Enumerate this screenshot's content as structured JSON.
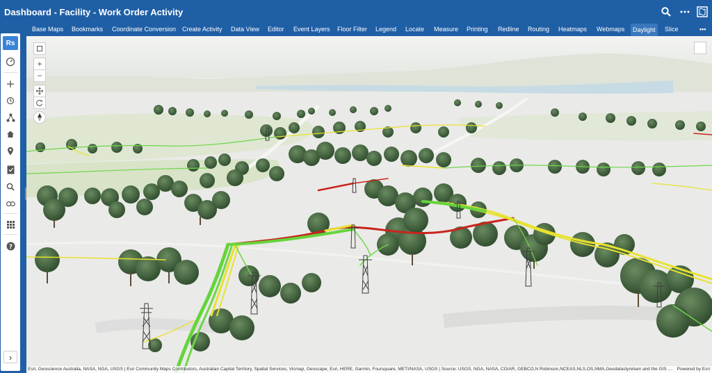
{
  "header": {
    "title": "Dashboard - Facility - Work Order Activity"
  },
  "toolbar": {
    "items": [
      "Base Maps",
      "Bookmarks",
      "Coordinate Conversion",
      "Create Activity",
      "Data View",
      "Editor",
      "Event Layers",
      "Floor Filter",
      "Legend",
      "Locate",
      "Measure",
      "Printing",
      "Redline",
      "Routing",
      "Heatmaps",
      "Webmaps",
      "Daylight",
      "Slice"
    ],
    "active": "Daylight",
    "more": "•••"
  },
  "sidebar": {
    "logo": "Rs",
    "expand": "›"
  },
  "map": {
    "zoom_in": "+",
    "zoom_out": "−"
  },
  "attribution": {
    "text": "Esri, Geoscience Australia, NASA, NGA, USGS | Esri Community Maps Contributors, Australian Capital Territory, Spatial Services, Vicmap, Geoscape, Esri, HERE, Garmin, Foursquare, METI/NASA, USGS | Source: USGS, NGA, NASA, CGIAR, GEBCO,N Robinson,NCEAS,NLS,OS,NMA,Geodatastyrelsen and the GIS User Co...",
    "powered": "Powered by Esri"
  },
  "colors": {
    "header_bg": "#1f5fa6",
    "line_green": "#5cd43a",
    "line_yellow": "#e8e230",
    "line_red": "#c8241c"
  }
}
